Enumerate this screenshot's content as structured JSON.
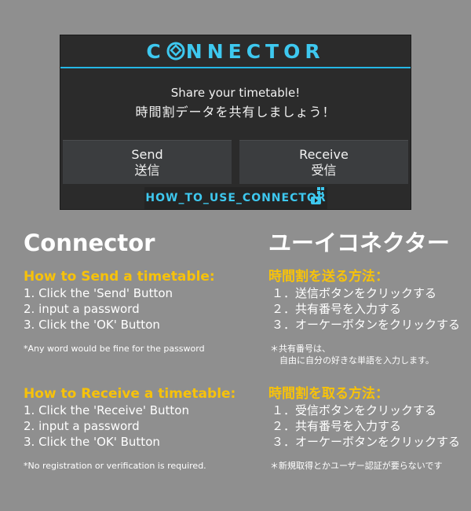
{
  "app": {
    "logo_text": "CONNECTOR",
    "accent_color": "#25b7e6"
  },
  "dialog": {
    "message_en": "Share your timetable!",
    "message_jp": "時間割データを共有しましょう！",
    "send_en": "Send",
    "send_jp": "送信",
    "receive_en": "Receive",
    "receive_jp": "受信",
    "banner_text": "HOW_TO_USE_CONNECTOR"
  },
  "english": {
    "title": "Connector",
    "send_heading": "How to Send a timetable:",
    "send_steps": [
      "1. Click the 'Send' Button",
      "2. input a password",
      "3. Click the 'OK' Button"
    ],
    "send_note": "*Any word would be fine for the password",
    "receive_heading": "How to Receive a timetable:",
    "receive_steps": [
      "1. Click the 'Receive' Button",
      "2. input a password",
      "3. Click the 'OK' Button"
    ],
    "receive_note": "*No registration or verification is required."
  },
  "japanese": {
    "title": "ユーイコネクター",
    "send_heading": "時間割を送る方法：",
    "send_steps": [
      "１．送信ボタンをクリックする",
      "２．共有番号を入力する",
      "３．オーケーボタンをクリックする"
    ],
    "send_note_1": "＊共有番号は、",
    "send_note_2": "自由に自分の好きな単語を入力します。",
    "receive_heading": "時間割を取る方法：",
    "receive_steps": [
      "１．受信ボタンをクリックする",
      "２．共有番号を入力する",
      "３．オーケーボタンをクリックする"
    ],
    "receive_note": "＊新規取得とかユーザー認証が要らないです"
  }
}
